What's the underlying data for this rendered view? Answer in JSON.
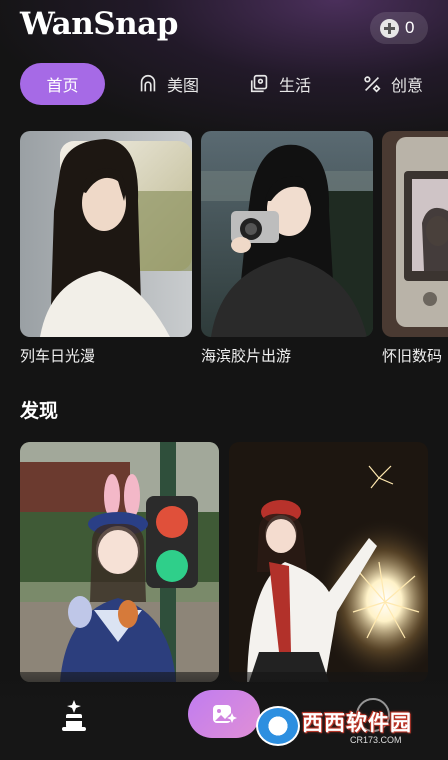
{
  "app": {
    "name": "WanSnap",
    "coins": "0",
    "coin_icon": "coin-plus-icon"
  },
  "tabs": [
    {
      "label": "首页",
      "icon": "",
      "active": true
    },
    {
      "label": "美图",
      "icon": "portrait-icon",
      "active": false
    },
    {
      "label": "生活",
      "icon": "picture-frame-icon",
      "active": false
    },
    {
      "label": "创意",
      "icon": "percent-creative-icon",
      "active": false
    }
  ],
  "featured": [
    {
      "caption": "列车日光漫"
    },
    {
      "caption": "海滨胶片出游"
    },
    {
      "caption": "怀旧数码"
    }
  ],
  "discover": {
    "title": "发现",
    "items": [
      {
        "name": "girl-with-traffic-light-photo"
      },
      {
        "name": "girl-with-sparkler-photo"
      }
    ]
  },
  "bottom_nav": {
    "home_icon": "magic-hat-icon",
    "create_icon": "add-image-sparkle-icon",
    "profile_icon": "profile-icon"
  },
  "watermark": {
    "main": "西西软件园",
    "sub": "CR173.COM"
  },
  "colors": {
    "accent": "#a66ae6",
    "background": "#141414",
    "create_gradient_start": "#c07cf0",
    "create_gradient_end": "#e08fd6"
  }
}
